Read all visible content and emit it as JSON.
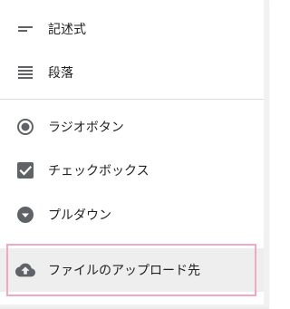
{
  "menu": {
    "items": [
      {
        "label": "記述式",
        "icon": "short-answer-icon"
      },
      {
        "label": "段落",
        "icon": "paragraph-icon"
      },
      {
        "label": "ラジオボタン",
        "icon": "radio-button-icon"
      },
      {
        "label": "チェックボックス",
        "icon": "checkbox-icon"
      },
      {
        "label": "プルダウン",
        "icon": "dropdown-icon"
      },
      {
        "label": "ファイルのアップロード先",
        "icon": "cloud-upload-icon"
      }
    ],
    "selected_index": 5
  },
  "colors": {
    "icon": "#5f6368",
    "text": "#202124",
    "divider": "#dadce0",
    "selected_bg": "#eeeeee",
    "highlight_border": "#f2a7c6"
  }
}
